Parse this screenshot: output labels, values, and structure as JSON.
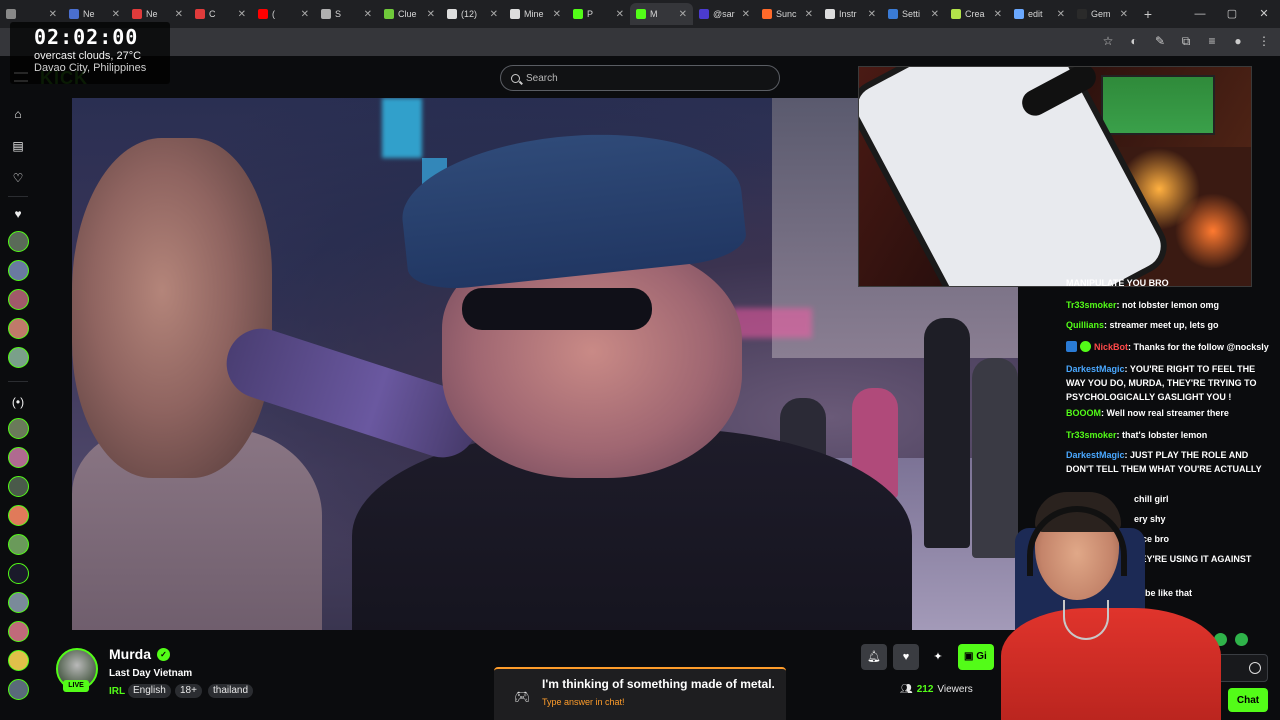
{
  "browser": {
    "tabs": [
      {
        "label": "",
        "color": "#888888"
      },
      {
        "label": "Ne",
        "color": "#4a6fd0"
      },
      {
        "label": "Ne",
        "color": "#e03b3b"
      },
      {
        "label": "C",
        "color": "#e03b3b"
      },
      {
        "label": "(",
        "color": "#ff0000"
      },
      {
        "label": "S",
        "color": "#b0b0b0"
      },
      {
        "label": "Clue",
        "color": "#6fc93a"
      },
      {
        "label": "(12)",
        "color": "#dddddd"
      },
      {
        "label": "Mine",
        "color": "#dddddd"
      },
      {
        "label": "P",
        "color": "#53fc18"
      },
      {
        "label": "M",
        "color": "#53fc18"
      },
      {
        "label": "@sar",
        "color": "#4b3bd0"
      },
      {
        "label": "Sunc",
        "color": "#ff6a2a"
      },
      {
        "label": "Instr",
        "color": "#dddddd"
      },
      {
        "label": "Setti",
        "color": "#3a7bd5"
      },
      {
        "label": "Crea",
        "color": "#b3e34a"
      },
      {
        "label": "edit",
        "color": "#6aa8ff"
      },
      {
        "label": "Gem",
        "color": "#2a2a2a"
      }
    ],
    "active_tab_index": 10,
    "new_tab": "+",
    "window_controls": [
      "—",
      "▢",
      "✕"
    ]
  },
  "clock": {
    "time": "02:02:00",
    "weather": "overcast clouds, 27°C",
    "location": "Davao City, Philippines"
  },
  "header": {
    "logo": "KICK",
    "search_placeholder": "Search"
  },
  "chat": {
    "messages": [
      {
        "user": "",
        "text": "MANIPULATE YOU BRO",
        "color": "#ffffff"
      },
      {
        "user": "Tr33smoker",
        "text": ": not lobster lemon omg",
        "color": "#53fc18"
      },
      {
        "user": "Quillians",
        "text": ": streamer meet up, lets go",
        "color": "#53fc18"
      },
      {
        "user": "NickBot",
        "text": ": Thanks for the follow @nocksly",
        "color": "#ff4a4a"
      },
      {
        "user": "DarkestMagic",
        "text": ": YOU'RE RIGHT TO FEEL THE WAY YOU DO, MURDA, THEY'RE TRYING TO PSYCHOLOGICALLY GASLIGHT YOU !",
        "color": "#4aa8ff"
      },
      {
        "user": "BOOOM",
        "text": ": Well now real streamer there",
        "color": "#53fc18"
      },
      {
        "user": "Tr33smoker",
        "text": ": that's lobster lemon",
        "color": "#53fc18"
      },
      {
        "user": "DarkestMagic",
        "text": ": JUST PLAY THE ROLE AND DON'T TELL THEM WHAT YOU'RE ACTUALLY",
        "color": "#4aa8ff"
      },
      {
        "user": "",
        "text": "chill girl",
        "color": "#ffffff"
      },
      {
        "user": "",
        "text": "ery shy",
        "color": "#ffffff"
      },
      {
        "user": "",
        "text": "nice bro",
        "color": "#ffffff"
      },
      {
        "user": "",
        "text": "HEY'RE USING IT AGAINST",
        "color": "#ffffff"
      },
      {
        "user": "",
        "text": "to be like that",
        "color": "#ffffff"
      }
    ],
    "send_label": "Chat"
  },
  "stream": {
    "streamer": "Murda",
    "live_label": "LIVE",
    "title": "Last Day Vietnam",
    "category": "IRL",
    "tags": [
      "English",
      "18+",
      "thailand"
    ],
    "viewers_count": "212",
    "viewers_label": "Viewers",
    "gift_label": "Gi"
  },
  "guess_widget": {
    "text": "I'm thinking of something made of metal.",
    "hint": "Type answer in chat!"
  }
}
